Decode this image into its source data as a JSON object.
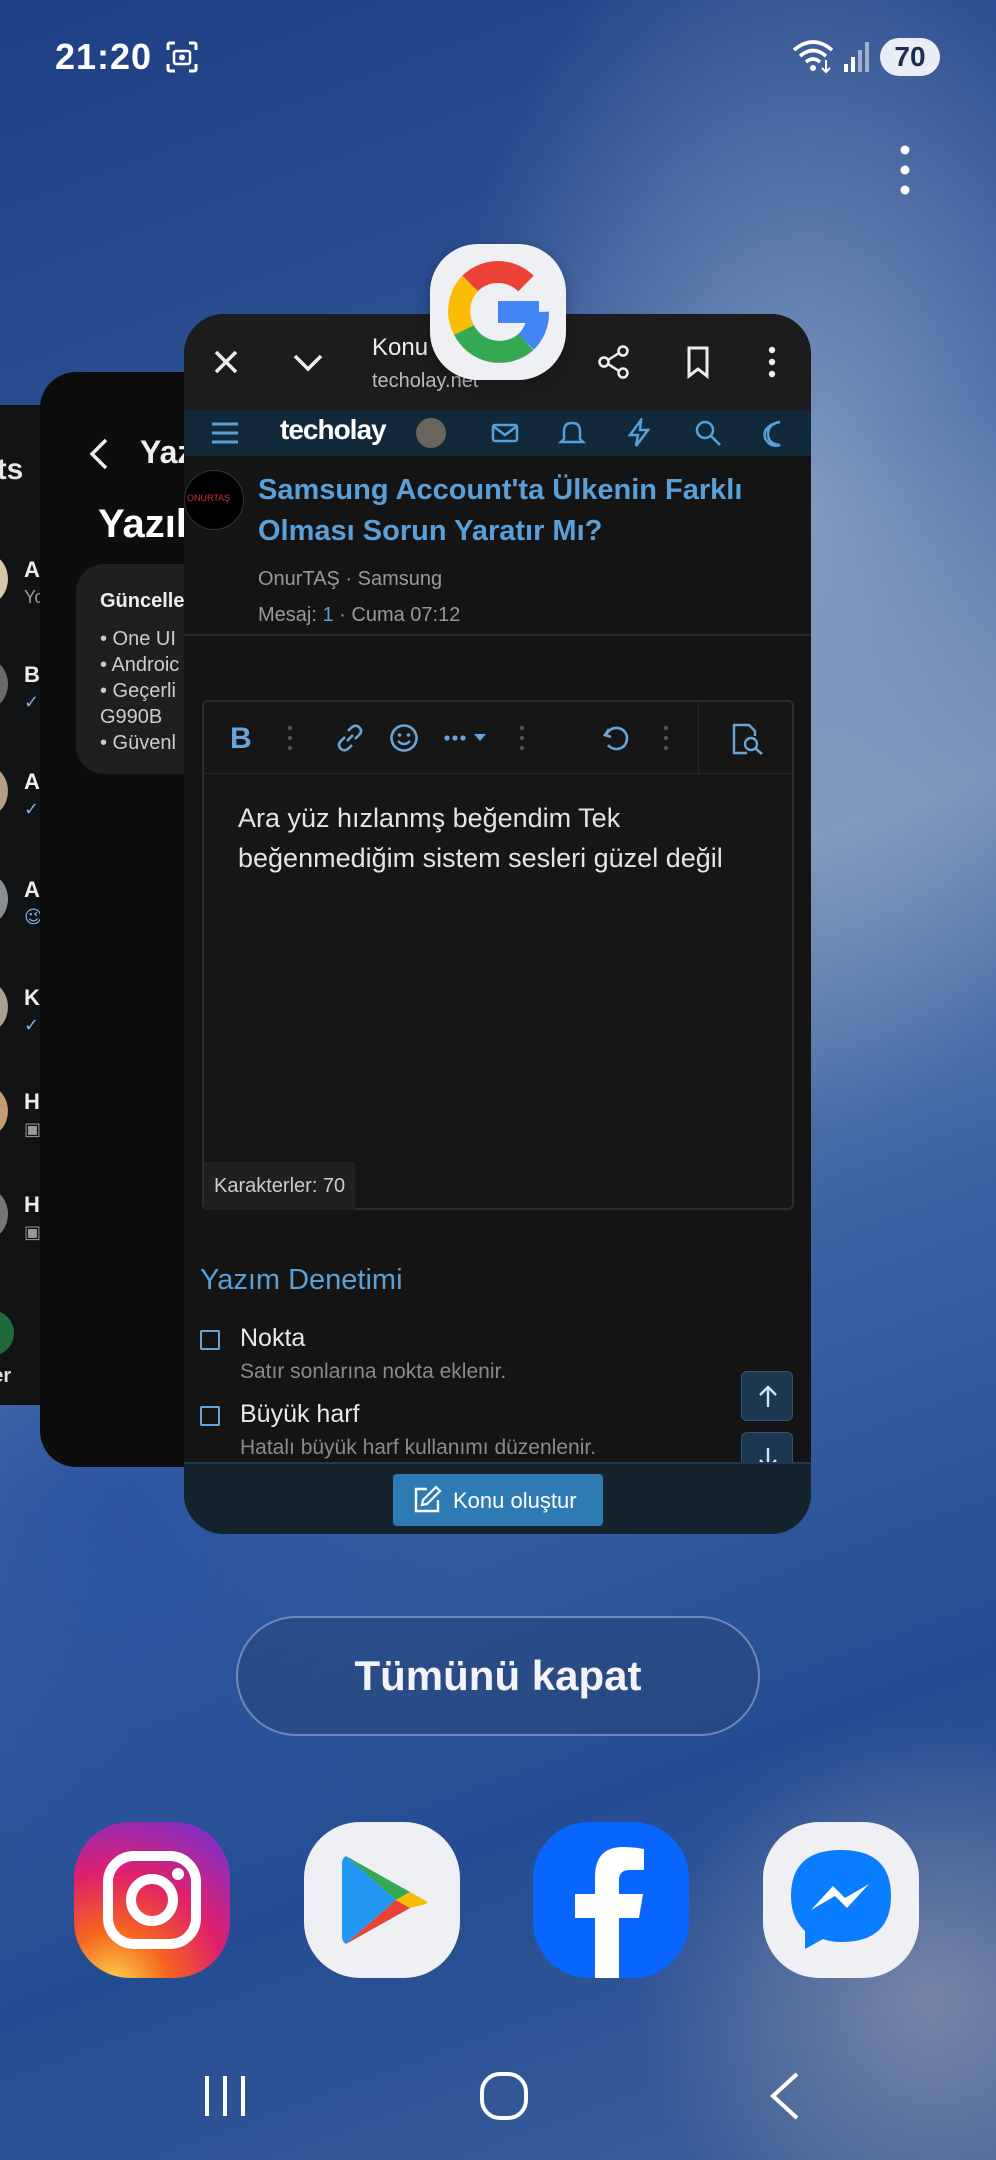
{
  "status_bar": {
    "time": "21:20",
    "battery_level": "70",
    "icons": [
      "screenshot-icon",
      "wifi-icon",
      "signal-icon"
    ]
  },
  "recents": {
    "menu_icon": "more-vertical-icon",
    "close_all_label": "Tümünü kapat"
  },
  "card_far": {
    "title": "ats",
    "rows": [
      {
        "letter": "A",
        "sub": "Yo"
      },
      {
        "letter": "B",
        "sub": "✓"
      },
      {
        "letter": "A",
        "sub": "✓"
      },
      {
        "letter": "A",
        "sub": "😉"
      },
      {
        "letter": "K",
        "sub": "✓"
      },
      {
        "letter": "H",
        "sub": "▣"
      },
      {
        "letter": "H",
        "sub": "▣"
      }
    ],
    "footer": "tler"
  },
  "card_mid": {
    "header_title": "Yaz",
    "big_title": "Yazıl",
    "panel_title": "Güncelle",
    "items": [
      "• One UI",
      "• Androic",
      "• Geçerli",
      "  G990B",
      "• Güvenl"
    ]
  },
  "main_card": {
    "app_icon": "google-app-icon",
    "browser": {
      "title": "Konu",
      "url": "techolay.net"
    },
    "site": {
      "logo": "techolay"
    },
    "thread": {
      "avatar_text": "ONURTAŞ",
      "title": "Samsung Account'ta Ülkenin Farklı Olması Sorun Yaratır Mı?",
      "author": "OnurTAŞ",
      "category": "Samsung",
      "meta_author_line": "OnurTAŞ · Samsung",
      "messages_label": "Mesaj:",
      "messages_count": "1",
      "date": "· Cuma 07:12"
    },
    "editor": {
      "bold_label": "B",
      "text": "Ara yüz hızlanmş beğendim Tek beğenmediğim sistem sesleri güzel değil",
      "char_count": "Karakterler: 70"
    },
    "spellcheck": {
      "title": "Yazım Denetimi",
      "options": [
        {
          "label": "Nokta",
          "description": "Satır sonlarına nokta eklenir.",
          "checked": false
        },
        {
          "label": "Büyük harf",
          "description": "Hatalı büyük harf kullanımı düzenlenir.",
          "checked": false
        }
      ]
    },
    "create_button": "Konu oluştur"
  },
  "dock": [
    "instagram-icon",
    "play-store-icon",
    "facebook-icon",
    "messenger-icon"
  ],
  "nav": [
    "recents-button",
    "home-button",
    "back-button"
  ]
}
